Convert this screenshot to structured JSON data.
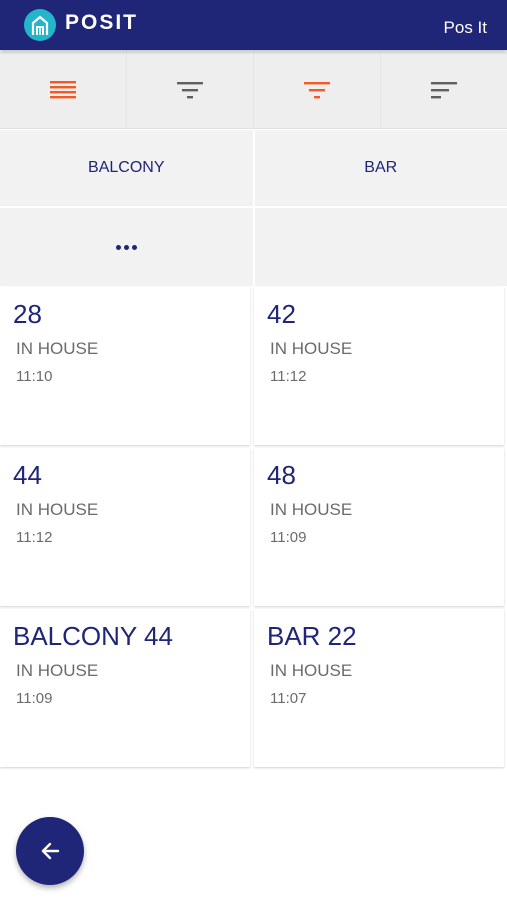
{
  "header": {
    "brand": "POSIT",
    "right_link": "Pos It",
    "logo_icon": "house-logo-icon",
    "color": "#1f2577",
    "logo_color": "#23b5c9"
  },
  "toolbar": {
    "icons": [
      "list-view-icon",
      "filter-icon",
      "filter-active-icon",
      "sort-icon"
    ],
    "active_color": "#f15a24"
  },
  "categories": [
    "BALCONY",
    "BAR"
  ],
  "more_icon": "more-dots-icon",
  "tables": [
    {
      "name": "28",
      "status": "IN HOUSE",
      "time": "11:10"
    },
    {
      "name": "42",
      "status": "IN HOUSE",
      "time": "11:12"
    },
    {
      "name": "44",
      "status": "IN HOUSE",
      "time": "11:12"
    },
    {
      "name": "48",
      "status": "IN HOUSE",
      "time": "11:09"
    },
    {
      "name": "BALCONY 44",
      "status": "IN HOUSE",
      "time": "11:09"
    },
    {
      "name": "BAR 22",
      "status": "IN HOUSE",
      "time": "11:07"
    }
  ],
  "fab_icon": "arrow-left-icon"
}
